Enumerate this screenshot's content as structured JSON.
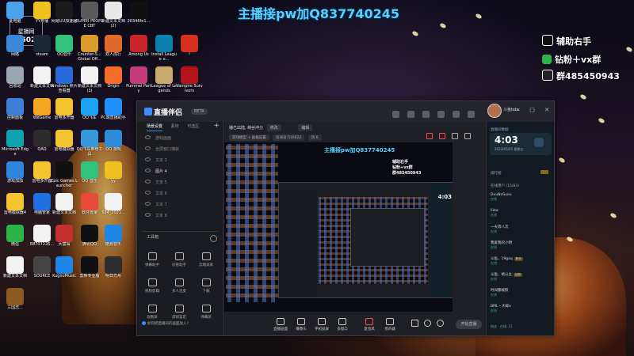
{
  "overlay": {
    "banner": "主播接pw加Q837740245",
    "right_lines": [
      {
        "text": "辅助右手",
        "icon": "tiktok-icon",
        "color": "#111111"
      },
      {
        "text": "钻粉＋vx群",
        "icon": "wechat-icon",
        "color": "#2bb44a"
      },
      {
        "text": "群485450943",
        "icon": "qq-penguin-icon",
        "color": "#222222"
      }
    ],
    "watermark_top": "星播网",
    "watermark_mid": "516022"
  },
  "desktop_icons": [
    {
      "label": "此电脑",
      "color": "#4aa3e8"
    },
    {
      "label": "YY开播",
      "color": "#f0c020"
    },
    {
      "label": "网易UU加速器",
      "color": "#1b1b1b"
    },
    {
      "label": "SUPER PEOPLE CBT",
      "color": "#5a5a5a"
    },
    {
      "label": "新建文本文档 (2)",
      "color": "#e8e8e8"
    },
    {
      "label": "20346fe1...",
      "color": "#111111"
    },
    {
      "label": "网络",
      "color": "#3a86d8"
    },
    {
      "label": "steam",
      "color": "#1b2838"
    },
    {
      "label": "QQ音乐",
      "color": "#31c27c"
    },
    {
      "label": "Counter-S... Global Off...",
      "color": "#d99b2b"
    },
    {
      "label": "双人成行",
      "color": "#e06a2a"
    },
    {
      "label": "Among Us",
      "color": "#c9242b"
    },
    {
      "label": "Install League o...",
      "color": "#0a7fb0"
    },
    {
      "label": "!",
      "color": "#d83020"
    },
    {
      "label": "回收站",
      "color": "#9aa7b3"
    },
    {
      "label": "新建文本文档",
      "color": "#f2f2f2"
    },
    {
      "label": "windows 照片查看器",
      "color": "#2a6ad8"
    },
    {
      "label": "新建文本文档 (3)",
      "color": "#f2f2f2"
    },
    {
      "label": "Origin",
      "color": "#f56c2d"
    },
    {
      "label": "Pummel Party",
      "color": "#c23b7a"
    },
    {
      "label": "League of Legends",
      "color": "#c8aa6e"
    },
    {
      "label": "Vampire Survivors",
      "color": "#b3141c"
    },
    {
      "label": "控制面板",
      "color": "#3d7fd6"
    },
    {
      "label": "WeGame",
      "color": "#f5a623"
    },
    {
      "label": "雷电多开器",
      "color": "#f4c430"
    },
    {
      "label": "QQ飞车",
      "color": "#1da1f2"
    },
    {
      "label": "PC端直播助手",
      "color": "#1e90ff"
    },
    {
      "label": "Microsoft Edge",
      "color": "#0fa3b1"
    },
    {
      "label": "QAQ",
      "color": "#2c2c2c"
    },
    {
      "label": "雷电模拟器",
      "color": "#f4c430"
    },
    {
      "label": "QQ飞车推荐工具",
      "color": "#3498db"
    },
    {
      "label": "QQ 游戏",
      "color": "#2e8bd8"
    },
    {
      "label": "游戏加加",
      "color": "#2e86de"
    },
    {
      "label": "雷电多开器",
      "color": "#f4c430"
    },
    {
      "label": "Epic Games Launcher",
      "color": "#111111"
    },
    {
      "label": "QQ 音乐",
      "color": "#31c27c"
    },
    {
      "label": "yy",
      "color": "#f0c020"
    },
    {
      "label": "雷电模拟器4",
      "color": "#f4c430"
    },
    {
      "label": "电脑管家",
      "color": "#1f6fe0"
    },
    {
      "label": "新建文本文档",
      "color": "#f2f2f2"
    },
    {
      "label": "软件管家",
      "color": "#e84a3a"
    },
    {
      "label": "584_2021...",
      "color": "#f2f2f2"
    },
    {
      "label": "微信",
      "color": "#2bb44a"
    },
    {
      "label": "88707226...",
      "color": "#f2f2f2"
    },
    {
      "label": "大富翁",
      "color": "#c23030"
    },
    {
      "label": "腾讯QQ",
      "color": "#111111"
    },
    {
      "label": "酷狗音乐",
      "color": "#1f86e5"
    },
    {
      "label": "新建文本文档",
      "color": "#f2f2f2"
    },
    {
      "label": "SOURCE",
      "color": "#444444"
    },
    {
      "label": "KugouMusic",
      "color": "#1f86e5"
    },
    {
      "label": "剪映专业版",
      "color": "#111111"
    },
    {
      "label": "明日方舟",
      "color": "#2e2e2e"
    },
    {
      "label": "三国志...",
      "color": "#8a5a20"
    }
  ],
  "app": {
    "logo_text": "直播伴侣",
    "version_badge": "BETA",
    "user_name": "斗鱼bdw",
    "window_controls": [
      "—",
      "□",
      "✕"
    ],
    "sidebar": {
      "tabs": [
        {
          "label": "场景设置",
          "active": true
        },
        {
          "label": "素材",
          "active": false
        },
        {
          "label": "可选区",
          "active": false
        }
      ],
      "plus": "+",
      "scene_rows": [
        "游戏画面",
        "全屏窗口捕获",
        "文本 3",
        "图片 4",
        "文本 5",
        "文本 6",
        "文本 7",
        "文本 8"
      ],
      "tools_title": "工具箱",
      "tools": [
        {
          "label": "弹幕助手",
          "icon": "chat-icon"
        },
        {
          "label": "房管助手",
          "icon": "user-icon"
        },
        {
          "label": "云端录屏",
          "icon": "download-icon"
        },
        {
          "label": "视频剪辑",
          "icon": "scissors-icon"
        },
        {
          "label": "多人连麦",
          "icon": "mic-icon"
        },
        {
          "label": "下载",
          "icon": "download-icon"
        },
        {
          "label": "观看屏",
          "icon": "screen-icon"
        },
        {
          "label": "游戏鉴定",
          "icon": "check-icon"
        },
        {
          "label": "弹幕屏",
          "icon": "display-icon"
        }
      ],
      "tip_text": "如何把直播间的画面放入?"
    },
    "center": {
      "title_text": "播已出陆, 峡谷冲分",
      "chip_a": "修改",
      "chip_b": "编辑",
      "toolbar_chip_a": "游戏模型 + 画幅设置",
      "toolbar_room": "房间号:516022",
      "toolbar_views": "热 6",
      "preview_banner": "主播接pw加Q837740245",
      "preview_right": [
        "辅助右手",
        "钻粉+vx群",
        "群485450943"
      ],
      "preview_clock": "4:03",
      "bottom_buttons": [
        {
          "label": "直播画面",
          "icon": "screen-icon"
        },
        {
          "label": "摄像头",
          "icon": "camera-icon"
        },
        {
          "label": "手机投屏",
          "icon": "phone-icon"
        },
        {
          "label": "多窗口",
          "icon": "windows-icon"
        },
        {
          "label": "麦克风",
          "icon": "mic-icon"
        },
        {
          "label": "扬声器",
          "icon": "speaker-icon"
        }
      ],
      "go_live": "开始直播"
    },
    "chat": {
      "title": "直播间数据",
      "clock": "4:03",
      "date": "2023/05/05 星期五",
      "section1": "排行榜",
      "section2": "在线用户 (15/83)",
      "users": [
        {
          "name": "DuuNoSuou",
          "status": "在线",
          "tag": ""
        },
        {
          "name": "lilzw",
          "status": "在线",
          "tag": ""
        },
        {
          "name": "一天等八次",
          "status": "在线",
          "tag": ""
        },
        {
          "name": "我爱我的小明",
          "status": "在线",
          "tag": ""
        },
        {
          "name": "斗鱼、19gaq",
          "status": "在线",
          "tag": "粉丝"
        },
        {
          "name": "斗鱼、格公主",
          "status": "在线",
          "tag": "钻粉"
        },
        {
          "name": "时间都被照",
          "status": "在线",
          "tag": ""
        },
        {
          "name": "BML・大嫁o",
          "status": "在线",
          "tag": ""
        }
      ],
      "footer": "粉丝 · 在线: 15"
    }
  }
}
